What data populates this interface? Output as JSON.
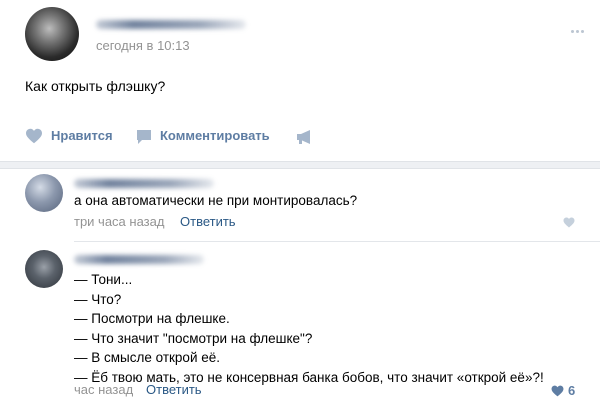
{
  "post": {
    "timestamp": "сегодня в 10:13",
    "text": "Как открыть флэшку?",
    "like_label": "Нравится",
    "comment_label": "Комментировать"
  },
  "comments": [
    {
      "text": "а она автоматически не при монтировалась?",
      "time": "три часа назад",
      "reply_label": "Ответить"
    },
    {
      "lines": [
        "— Тони...",
        "— Что?",
        "— Посмотри на флешке.",
        "— Что значит \"посмотри на флешке\"?",
        "— В смысле открой её.",
        "— Ёб твою мать, это не консервная банка бобов, что значит «открой её»?!"
      ],
      "time": "час назад",
      "reply_label": "Ответить",
      "likes": "6"
    }
  ],
  "colors": {
    "accent": "#5e7da3",
    "link": "#2a5885",
    "muted": "#939393"
  }
}
